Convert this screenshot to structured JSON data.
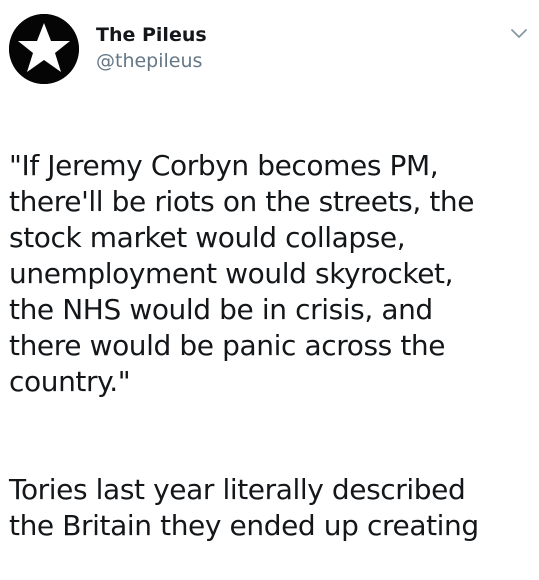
{
  "author": {
    "display_name": "The Pileus",
    "handle": "@thepileus",
    "avatar_icon": "star-icon"
  },
  "menu": {
    "icon": "chevron-down-icon"
  },
  "tweet": {
    "paragraph_1": "\"If Jeremy Corbyn becomes PM,\nthere'll be riots on the streets, the\nstock market would collapse,\nunemployment would skyrocket,\nthe NHS would be in crisis, and\nthere would be panic across the\ncountry.\"",
    "paragraph_2": "Tories last year literally described\nthe Britain they ended up creating"
  },
  "colors": {
    "text": "#14171a",
    "secondary_text": "#657786",
    "avatar_background": "#050505",
    "star": "#ffffff"
  }
}
